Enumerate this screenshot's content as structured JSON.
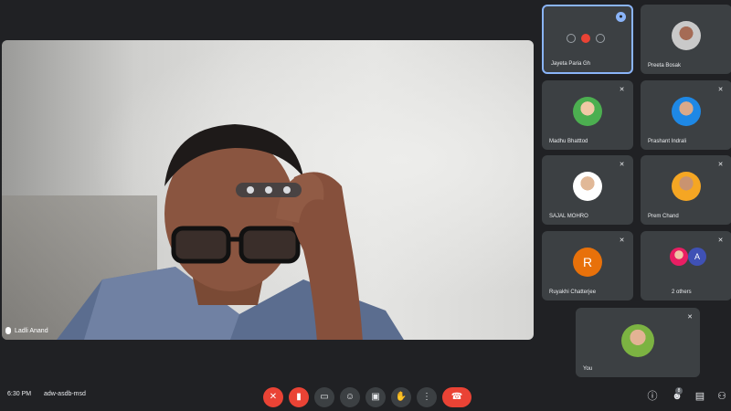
{
  "meeting": {
    "time": "6:30 PM",
    "code": "adw-asdb-msd"
  },
  "main_speaker": {
    "name": "Ladli Anand"
  },
  "participants": [
    {
      "name": "Jayeta Paria Gh",
      "avatar": "recording-controls",
      "selected": true,
      "pinned": true
    },
    {
      "name": "Preeta Bosak",
      "avatar": "photo"
    },
    {
      "name": "Madhu Bhatttod",
      "avatar": "photo"
    },
    {
      "name": "Prashant Indrali",
      "avatar": "photo"
    },
    {
      "name": "SAJAL MOHRO",
      "avatar": "photo"
    },
    {
      "name": "Prem Chand",
      "avatar": "photo"
    },
    {
      "name": "Ruyakhi Chatterjee",
      "avatar": "letter",
      "letter": "R"
    },
    {
      "name": "2 others",
      "avatar": "pair",
      "letter": "A"
    }
  ],
  "self": {
    "name": "You"
  },
  "controls": {
    "mic": "mic-off-icon",
    "camera": "camera-off-icon",
    "captions": "cc-icon",
    "emoji": "emoji-icon",
    "present": "present-icon",
    "hand": "hand-icon",
    "more": "more-icon",
    "hangup": "hangup-icon"
  },
  "right_controls": {
    "info": "info-icon",
    "people": "people-icon",
    "people_count": "8",
    "chat": "chat-icon",
    "activities": "activities-icon"
  },
  "colors": {
    "background": "#202124",
    "tile": "#3c4043",
    "red": "#ea4335",
    "accent": "#8ab4f8"
  }
}
